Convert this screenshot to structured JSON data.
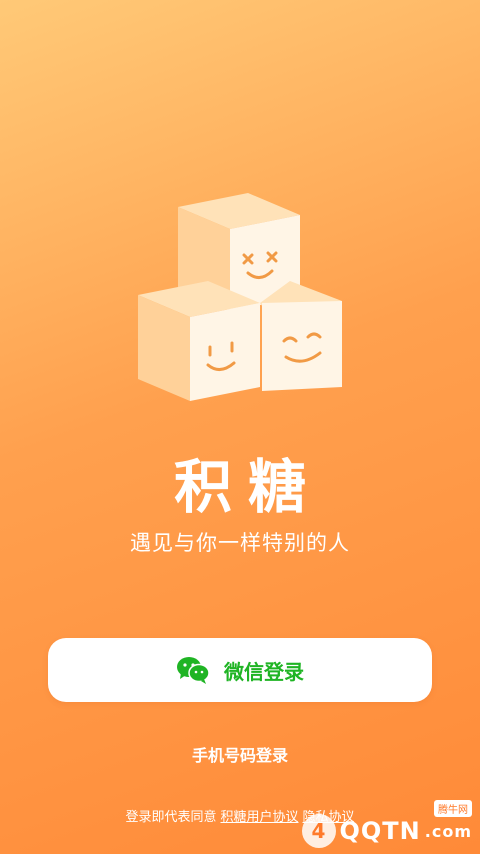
{
  "brand": {
    "name": "积糖",
    "slogan": "遇见与你一样特别的人"
  },
  "login": {
    "wechat_label": "微信登录",
    "phone_label": "手机号码登录",
    "agreement_prefix": "登录即代表同意",
    "user_agreement": "积糖用户协议",
    "privacy_agreement": "隐私协议"
  },
  "watermark": {
    "text": "QQTN",
    "domain": ".com",
    "tag": "腾牛网"
  },
  "colors": {
    "accent_green": "#1fb424",
    "bg_top": "#ffc977",
    "bg_bottom": "#ff8a38"
  }
}
